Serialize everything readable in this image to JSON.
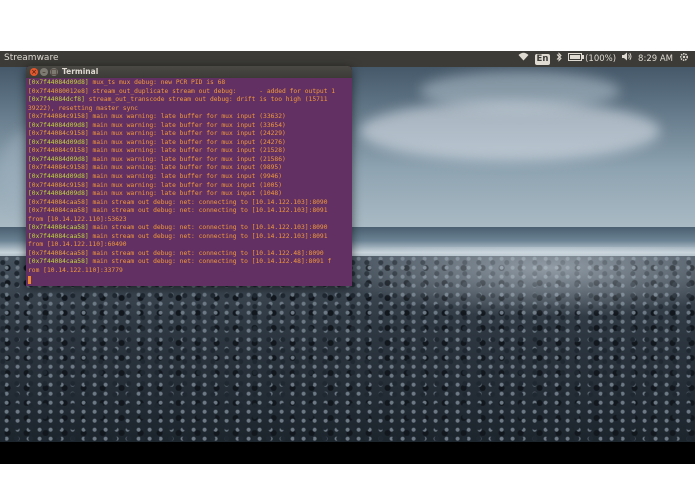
{
  "topbar": {
    "app_name": "Streamware",
    "keyboard_layout": "En",
    "battery_label": "(100%)",
    "time": "8:29 AM"
  },
  "terminal": {
    "title": "Terminal",
    "lines": [
      {
        "addr": "[0x7f44084d09d8]",
        "msg": " mux_ts mux debug: new PCR PID is 68",
        "green": true
      },
      {
        "addr": "[0x7f44080012e8]",
        "msg": " stream_out_duplicate stream out debug:      - added for output 1",
        "green": false
      },
      {
        "addr": "[0x7f44084dcf8]",
        "msg": " stream_out_transcode stream out debug: drift is too high (15711",
        "green": true
      },
      {
        "addr": "",
        "msg": "39222), resetting master sync",
        "green": false
      },
      {
        "addr": "[0x7f44084c9158]",
        "msg": " main mux warning: late buffer for mux input (33632)",
        "green": false
      },
      {
        "addr": "[0x7f44084d09d8]",
        "msg": " main mux warning: late buffer for mux input (33654)",
        "green": true
      },
      {
        "addr": "[0x7f44084c9158]",
        "msg": " main mux warning: late buffer for mux input (24229)",
        "green": false
      },
      {
        "addr": "[0x7f44084d09d8]",
        "msg": " main mux warning: late buffer for mux input (24276)",
        "green": true
      },
      {
        "addr": "[0x7f44084c9158]",
        "msg": " main mux warning: late buffer for mux input (21528)",
        "green": false
      },
      {
        "addr": "[0x7f44084d09d8]",
        "msg": " main mux warning: late buffer for mux input (21586)",
        "green": true
      },
      {
        "addr": "[0x7f44084c9158]",
        "msg": " main mux warning: late buffer for mux input (9895)",
        "green": false
      },
      {
        "addr": "[0x7f44084d09d8]",
        "msg": " main mux warning: late buffer for mux input (9946)",
        "green": true
      },
      {
        "addr": "[0x7f44084c9158]",
        "msg": " main mux warning: late buffer for mux input (1005)",
        "green": false
      },
      {
        "addr": "[0x7f44084d09d8]",
        "msg": " main mux warning: late buffer for mux input (1048)",
        "green": true
      },
      {
        "addr": "[0x7f44084caa58]",
        "msg": " main stream out debug: net: connecting to [10.14.122.103]:8090",
        "green": false
      },
      {
        "addr": "[0x7f44084caa58]",
        "msg": " main stream out debug: net: connecting to [10.14.122.103]:8091",
        "green": false
      },
      {
        "addr": "",
        "msg": "from [10.14.122.110]:53623",
        "green": false
      },
      {
        "addr": "[0x7f44084caa58]",
        "msg": " main stream out debug: net: connecting to [10.14.122.103]:8090",
        "green": true
      },
      {
        "addr": "[0x7f44084caa58]",
        "msg": " main stream out debug: net: connecting to [10.14.122.103]:8091",
        "green": true
      },
      {
        "addr": "",
        "msg": "from [10.14.122.110]:60490",
        "green": false
      },
      {
        "addr": "[0x7f44084caa58]",
        "msg": " main stream out debug: net: connecting to [10.14.122.48]:8090",
        "green": false
      },
      {
        "addr": "[0x7f44084caa58]",
        "msg": " main stream out debug: net: connecting to [10.14.122.48]:8091 f",
        "green": true
      },
      {
        "addr": "",
        "msg": "rom [10.14.122.110]:33779",
        "green": false
      }
    ]
  },
  "icons": {
    "wifi": "wifi-icon",
    "bluetooth": "bluetooth-icon",
    "battery": "battery-icon",
    "volume": "volume-icon",
    "settings": "gear-icon"
  }
}
